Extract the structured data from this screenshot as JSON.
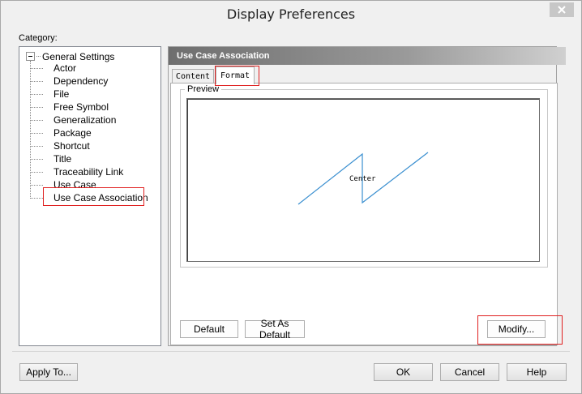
{
  "window": {
    "title": "Display Preferences",
    "close_icon": "close-icon"
  },
  "category_label": "Category:",
  "tree": {
    "root": "General Settings",
    "items": [
      "Actor",
      "Dependency",
      "File",
      "Free Symbol",
      "Generalization",
      "Package",
      "Shortcut",
      "Title",
      "Traceability Link",
      "Use Case",
      "Use Case Association"
    ],
    "selected": "Use Case Association"
  },
  "panel": {
    "header": "Use Case Association",
    "tabs": [
      {
        "label": "Content"
      },
      {
        "label": "Format"
      }
    ],
    "active_tab": "Format",
    "preview_label": "Preview",
    "preview_text": "Center",
    "line_color": "#3a8fd0"
  },
  "buttons": {
    "default": "Default",
    "set_as_default": "Set As Default",
    "modify": "Modify...",
    "apply_to": "Apply To...",
    "ok": "OK",
    "cancel": "Cancel",
    "help": "Help"
  },
  "annotation_color": "#e02020"
}
